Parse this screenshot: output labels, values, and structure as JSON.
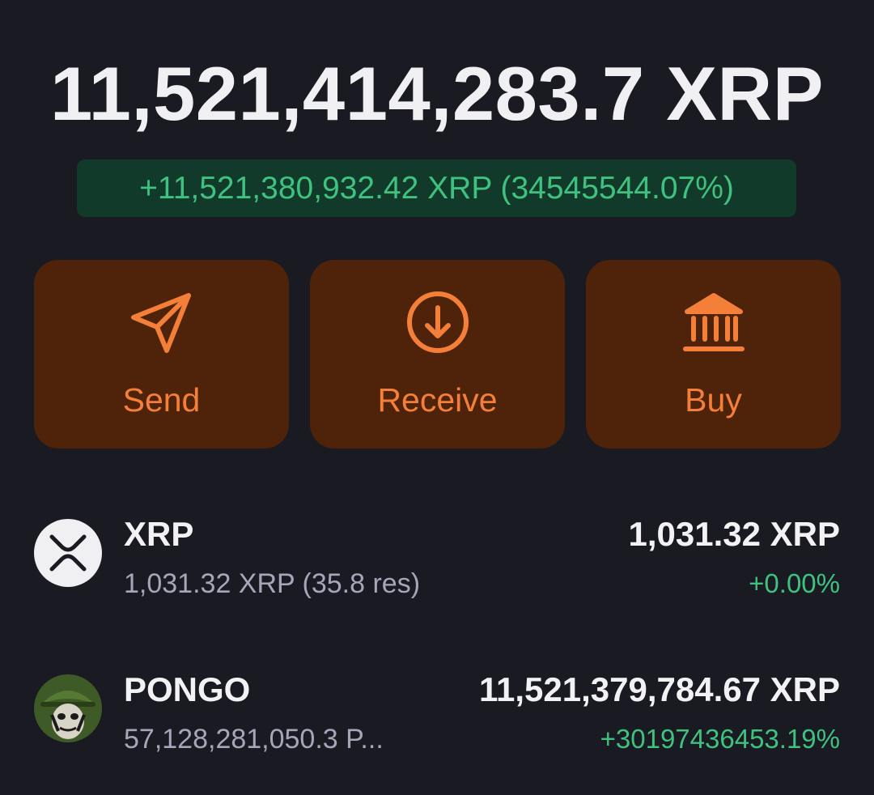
{
  "portfolio": {
    "total": "11,521,414,283.7 XRP",
    "change": "+11,521,380,932.42 XRP (34545544.07%)"
  },
  "actions": {
    "send": {
      "label": "Send",
      "icon": "send-paper-plane-icon"
    },
    "receive": {
      "label": "Receive",
      "icon": "receive-arrow-down-circle-icon"
    },
    "buy": {
      "label": "Buy",
      "icon": "bank-icon"
    }
  },
  "assets": [
    {
      "name": "XRP",
      "sub": "1,031.32 XRP (35.8 res)",
      "value": "1,031.32 XRP",
      "change": "+0.00%",
      "logo": "xrp-logo"
    },
    {
      "name": "PONGO",
      "sub": "57,128,281,050.3 P...",
      "value": "11,521,379,784.67 XRP",
      "change": "+30197436453.19%",
      "logo": "pongo-avatar"
    }
  ],
  "colors": {
    "background": "#191a22",
    "accent": "#f47f38",
    "action_bg": "#4e2309",
    "positive": "#3fc27f",
    "positive_bg": "#113a2a"
  }
}
